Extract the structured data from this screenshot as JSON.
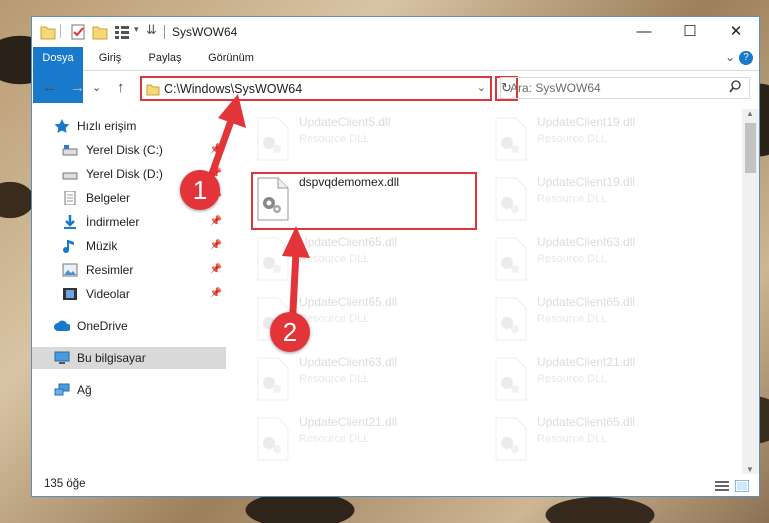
{
  "window": {
    "title": "SysWOW64",
    "minimize": "—",
    "maximize": "☐",
    "close": "✕"
  },
  "ribbon": {
    "tabs": [
      "Dosya",
      "Giriş",
      "Paylaş",
      "Görünüm"
    ],
    "expand": "⌄",
    "help": "?"
  },
  "nav": {
    "back": "←",
    "forward": "→",
    "recent": "⌄",
    "up": "↑"
  },
  "address": {
    "path": "C:\\Windows\\SysWOW64",
    "dropdown": "⌄",
    "refresh": "↻"
  },
  "search": {
    "placeholder": "Ara: SysWOW64",
    "icon": "search-icon"
  },
  "sidebar": {
    "items": [
      {
        "label": "Hızlı erişim",
        "icon": "star-icon"
      },
      {
        "label": "Yerel Disk (C:)",
        "icon": "drive-icon"
      },
      {
        "label": "Yerel Disk (D:)",
        "icon": "drive-icon"
      },
      {
        "label": "Belgeler",
        "icon": "documents-icon"
      },
      {
        "label": "İndirmeler",
        "icon": "download-icon"
      },
      {
        "label": "Müzik",
        "icon": "music-icon"
      },
      {
        "label": "Resimler",
        "icon": "pictures-icon"
      },
      {
        "label": "Videolar",
        "icon": "video-icon"
      },
      {
        "label": "OneDrive",
        "icon": "cloud-icon"
      },
      {
        "label": "Bu bilgisayar",
        "icon": "computer-icon"
      },
      {
        "label": "Ağ",
        "icon": "network-icon"
      }
    ]
  },
  "files": {
    "col1": [
      {
        "name": "UpdateClient5.dll",
        "type": "Resource DLL"
      },
      {
        "name": "dspvqdemomex.dll",
        "type": ""
      },
      {
        "name": "UpdateClient65.dll",
        "type": "Resource DLL"
      },
      {
        "name": "UpdateClient65.dll",
        "type": "Resource DLL"
      },
      {
        "name": "UpdateClient63.dll",
        "type": "Resource DLL"
      },
      {
        "name": "UpdateClient21.dll",
        "type": "Resource DLL"
      }
    ],
    "col2": [
      {
        "name": "UpdateClient19.dll",
        "type": "Resource DLL"
      },
      {
        "name": "UpdateClient19.dll",
        "type": "Resource DLL"
      },
      {
        "name": "UpdateClient63.dll",
        "type": "Resource DLL"
      },
      {
        "name": "UpdateClient65.dll",
        "type": "Resource DLL"
      },
      {
        "name": "UpdateClient21.dll",
        "type": "Resource DLL"
      },
      {
        "name": "UpdateClient65.dll",
        "type": "Resource DLL"
      }
    ]
  },
  "status": {
    "count": "135 öğe"
  },
  "markers": {
    "one": "1",
    "two": "2"
  },
  "colors": {
    "accent": "#1979ca",
    "highlight": "#e0353b"
  }
}
